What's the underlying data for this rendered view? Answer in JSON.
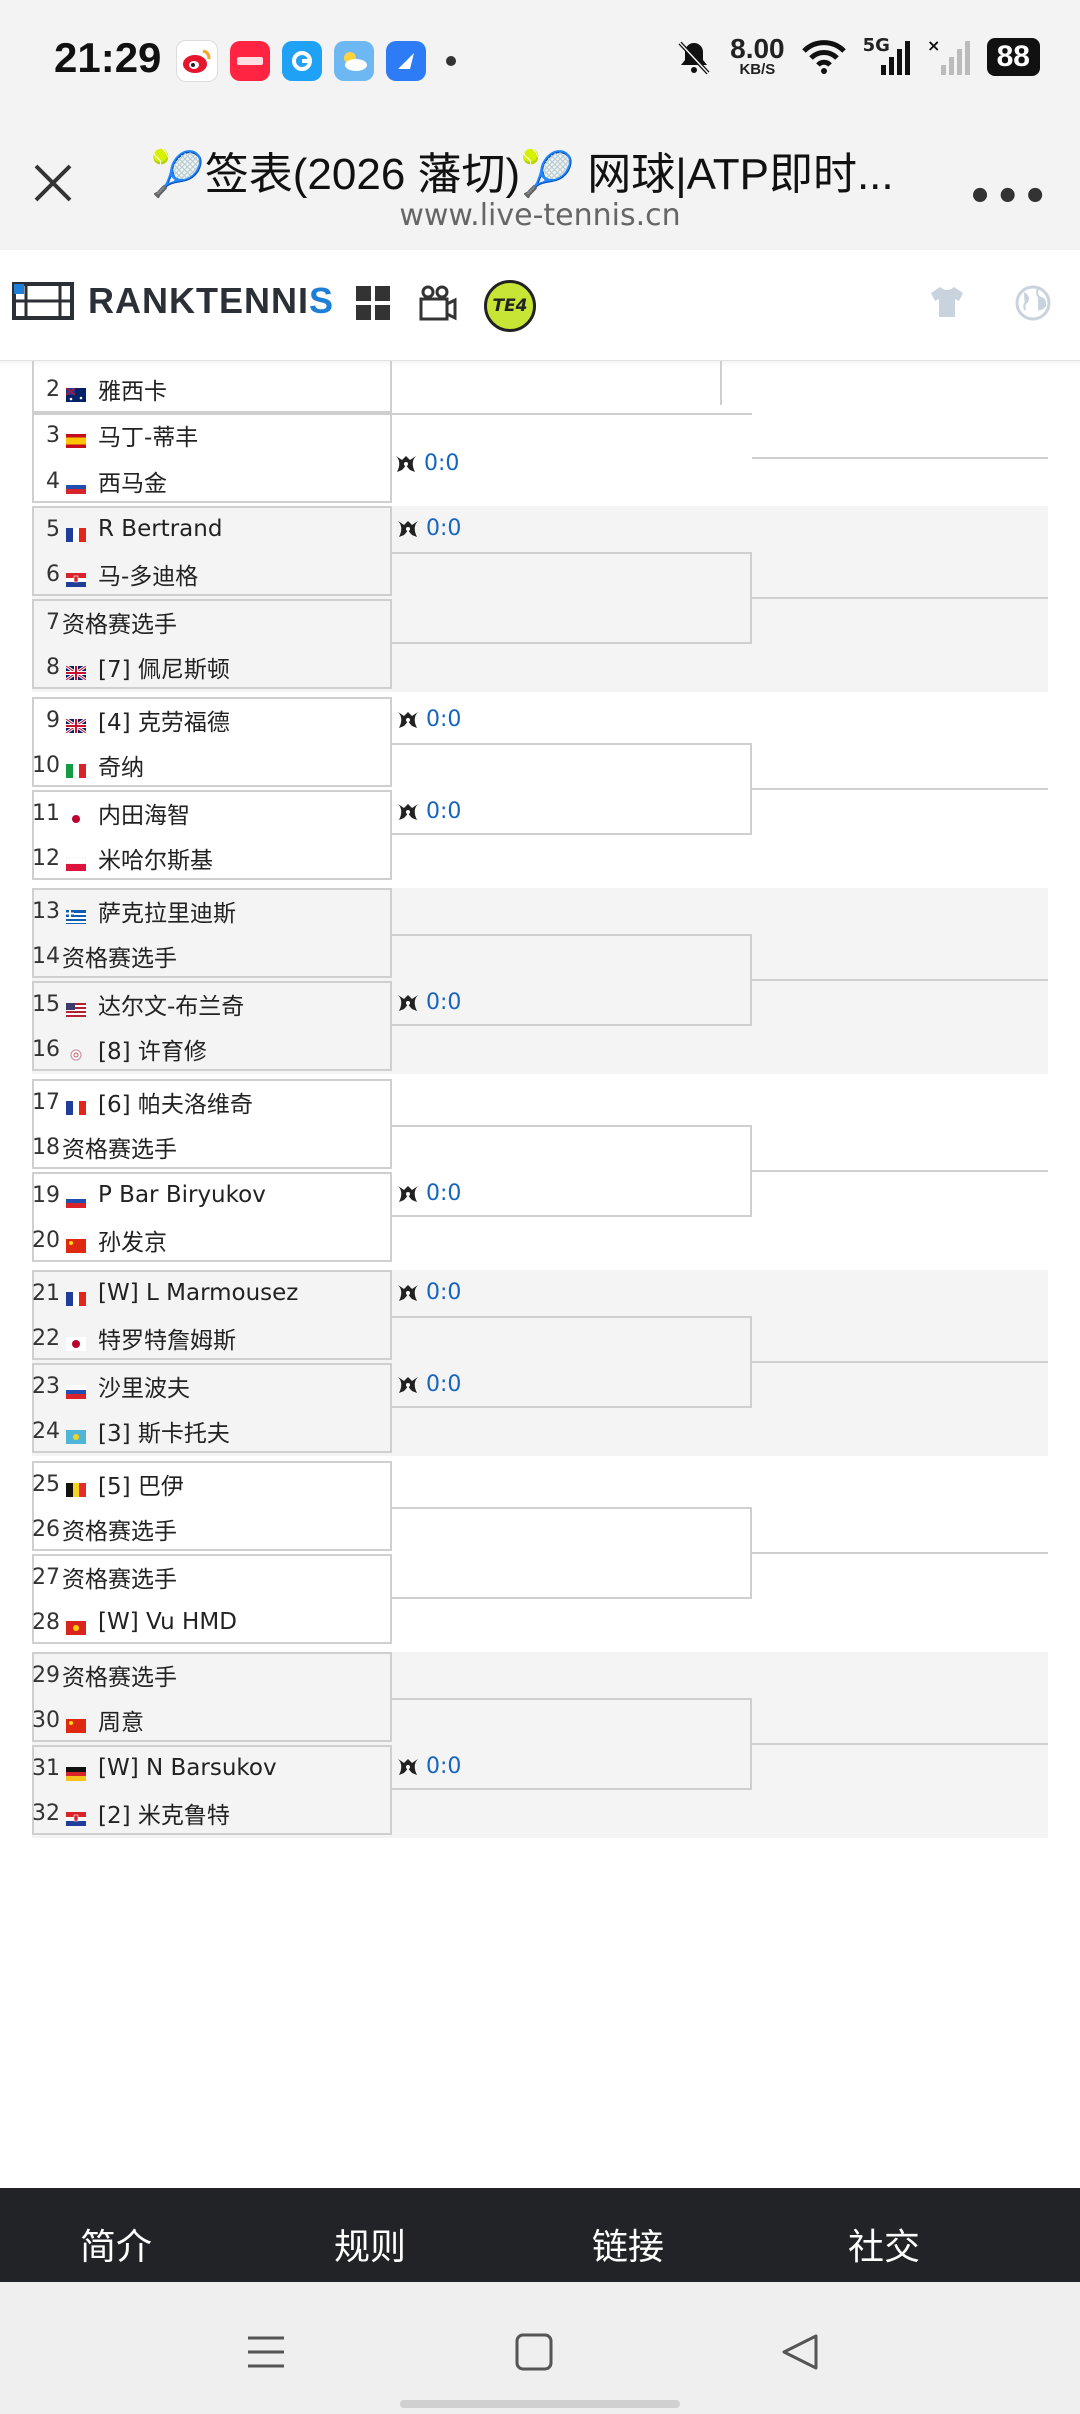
{
  "status_bar": {
    "time": "21:29",
    "net_speed": "8.00",
    "net_unit": "KB/S",
    "signal": "5G",
    "battery": "88",
    "icons": [
      "weibo-icon",
      "xiaohongshu-icon",
      "app-icon",
      "weather-icon",
      "browser-icon",
      "mute-icon",
      "wifi-icon",
      "signal-icon"
    ]
  },
  "browser": {
    "title": "🎾签表(2026 藩切)🎾 网球|ATP即时...",
    "url": "www.live-tennis.cn"
  },
  "site": {
    "logo_main": "RANKTENNI",
    "logo_accent": "S"
  },
  "draw": {
    "partial_player": {
      "no": "2",
      "name": "雅西卡",
      "flag": "AU"
    },
    "blocks": [
      {
        "players": [
          {
            "no": "3",
            "name": "马丁-蒂丰",
            "flag": "ES"
          },
          {
            "no": "4",
            "name": "西马金",
            "flag": "RU"
          }
        ],
        "scores": [
          null,
          "0:0"
        ]
      },
      {
        "players": [
          {
            "no": "5",
            "name": "R Bertrand",
            "flag": "FR"
          },
          {
            "no": "6",
            "name": "马-多迪格",
            "flag": "HR"
          },
          {
            "no": "7",
            "name": "资格赛选手",
            "flag": ""
          },
          {
            "no": "8",
            "name": "[7] 佩尼斯顿",
            "flag": "GB"
          }
        ],
        "scores": [
          "0:0",
          null
        ]
      },
      {
        "players": [
          {
            "no": "9",
            "name": "[4] 克劳福德",
            "flag": "GB"
          },
          {
            "no": "10",
            "name": "奇纳",
            "flag": "IT"
          },
          {
            "no": "11",
            "name": "内田海智",
            "flag": "JP"
          },
          {
            "no": "12",
            "name": "米哈尔斯基",
            "flag": "PL"
          }
        ],
        "scores": [
          "0:0",
          "0:0"
        ]
      },
      {
        "players": [
          {
            "no": "13",
            "name": "萨克拉里迪斯",
            "flag": "GR"
          },
          {
            "no": "14",
            "name": "资格赛选手",
            "flag": ""
          },
          {
            "no": "15",
            "name": "达尔文-布兰奇",
            "flag": "US"
          },
          {
            "no": "16",
            "name": "[8] 许育修",
            "flag": "TPE"
          }
        ],
        "scores": [
          null,
          "0:0"
        ]
      },
      {
        "players": [
          {
            "no": "17",
            "name": "[6] 帕夫洛维奇",
            "flag": "FR"
          },
          {
            "no": "18",
            "name": "资格赛选手",
            "flag": ""
          },
          {
            "no": "19",
            "name": "P Bar Biryukov",
            "flag": "RU"
          },
          {
            "no": "20",
            "name": "孙发京",
            "flag": "CN"
          }
        ],
        "scores": [
          null,
          "0:0"
        ]
      },
      {
        "players": [
          {
            "no": "21",
            "name": "[W] L Marmousez",
            "flag": "FR"
          },
          {
            "no": "22",
            "name": "特罗特詹姆斯",
            "flag": "JP"
          },
          {
            "no": "23",
            "name": "沙里波夫",
            "flag": "RU"
          },
          {
            "no": "24",
            "name": "[3] 斯卡托夫",
            "flag": "KZ"
          }
        ],
        "scores": [
          "0:0",
          "0:0"
        ]
      },
      {
        "players": [
          {
            "no": "25",
            "name": "[5] 巴伊",
            "flag": "BE"
          },
          {
            "no": "26",
            "name": "资格赛选手",
            "flag": ""
          },
          {
            "no": "27",
            "name": "资格赛选手",
            "flag": ""
          },
          {
            "no": "28",
            "name": "[W] Vu HMD",
            "flag": "VN"
          }
        ],
        "scores": [
          null,
          null
        ]
      },
      {
        "players": [
          {
            "no": "29",
            "name": "资格赛选手",
            "flag": ""
          },
          {
            "no": "30",
            "name": "周意",
            "flag": "CN"
          },
          {
            "no": "31",
            "name": "[W] N Barsukov",
            "flag": "DE"
          },
          {
            "no": "32",
            "name": "[2] 米克鲁特",
            "flag": "HR"
          }
        ],
        "scores": [
          null,
          "0:0"
        ]
      }
    ]
  },
  "footer": {
    "items": [
      "简介",
      "规则",
      "链接",
      "社交"
    ]
  }
}
